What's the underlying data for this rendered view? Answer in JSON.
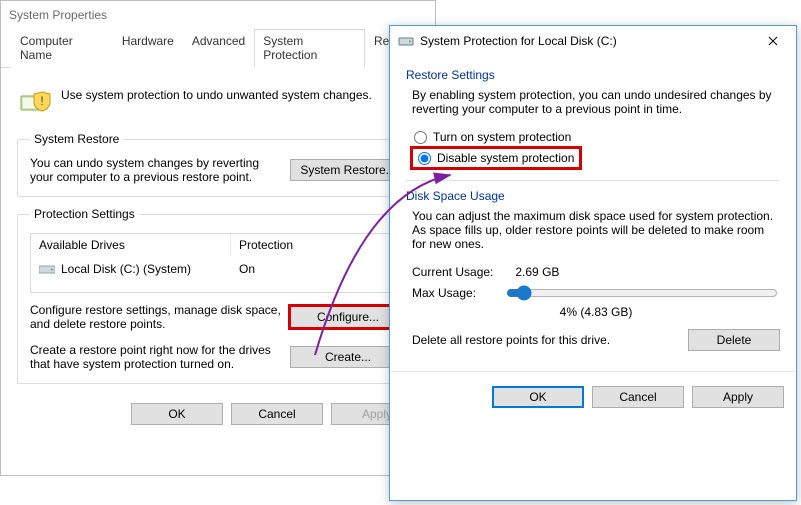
{
  "sysprops": {
    "title": "System Properties",
    "tabs": {
      "computer_name": "Computer Name",
      "hardware": "Hardware",
      "advanced": "Advanced",
      "system_protection": "System Protection",
      "remote": "Remote"
    },
    "intro": "Use system protection to undo unwanted system changes.",
    "system_restore": {
      "legend": "System Restore",
      "desc": "You can undo system changes by reverting your computer to a previous restore point.",
      "button": "System Restore..."
    },
    "protection_settings": {
      "legend": "Protection Settings",
      "columns": {
        "drive": "Available Drives",
        "protection": "Protection"
      },
      "rows": [
        {
          "drive": "Local Disk (C:) (System)",
          "protection": "On"
        }
      ],
      "configure_desc": "Configure restore settings, manage disk space, and delete restore points.",
      "configure_button": "Configure...",
      "create_desc": "Create a restore point right now for the drives that have system protection turned on.",
      "create_button": "Create..."
    },
    "footer": {
      "ok": "OK",
      "cancel": "Cancel",
      "apply": "Apply"
    }
  },
  "spd": {
    "title": "System Protection for Local Disk (C:)",
    "restore": {
      "section": "Restore Settings",
      "desc": "By enabling system protection, you can undo undesired changes by reverting your computer to a previous point in time.",
      "opt_on": "Turn on system protection",
      "opt_off": "Disable system protection"
    },
    "disk": {
      "section": "Disk Space Usage",
      "desc": "You can adjust the maximum disk space used for system protection. As space fills up, older restore points will be deleted to make room for new ones.",
      "current_label": "Current Usage:",
      "current_value": "2.69 GB",
      "max_label": "Max Usage:",
      "readout": "4% (4.83 GB)",
      "delete_desc": "Delete all restore points for this drive.",
      "delete_button": "Delete"
    },
    "footer": {
      "ok": "OK",
      "cancel": "Cancel",
      "apply": "Apply"
    }
  }
}
